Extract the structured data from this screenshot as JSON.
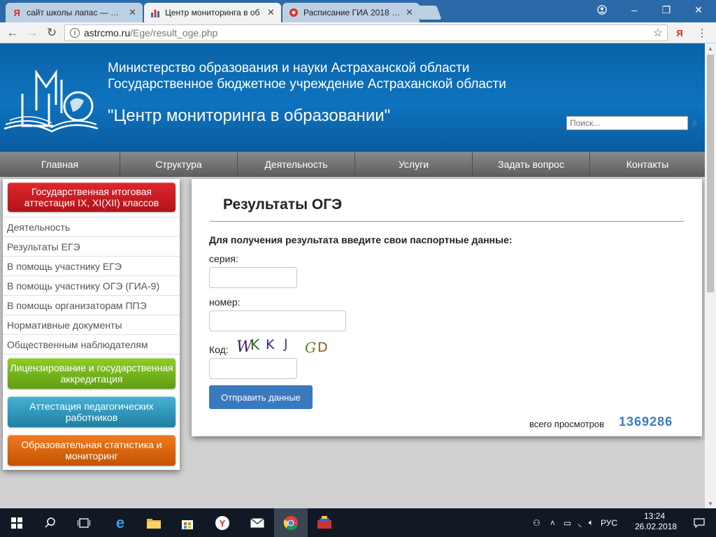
{
  "browser": {
    "tabs": [
      {
        "favicon": "Я",
        "title": "сайт школы лапас — Янд",
        "active": false
      },
      {
        "favicon": "chart-icon",
        "title": "Центр мониторинга в об",
        "active": true
      },
      {
        "favicon": "globe-icon",
        "title": "Расписание ГИА 2018 / О",
        "active": false
      }
    ],
    "url_host": "astrcmo.ru",
    "url_path": "/Ege/result_oge.php"
  },
  "header": {
    "org_line1": "Министерство образования и науки Астраханской области",
    "org_line2": "Государственное бюджетное учреждение Астраханской области",
    "org_line3": "\"Центр мониторинга в образовании\"",
    "search_placeholder": "Поиск..."
  },
  "nav": [
    "Главная",
    "Структура",
    "Деятельность",
    "Услуги",
    "Задать вопрос",
    "Контакты"
  ],
  "sidebar": {
    "top_button": "Государственная итоговая аттестация IX, XI(XII) классов",
    "links": [
      "Деятельность",
      "Результаты ЕГЭ",
      "В помощь участнику ЕГЭ",
      "В помощь участнику ОГЭ (ГИА-9)",
      "В помощь организаторам ППЭ",
      "Нормативные документы",
      "Общественным наблюдателям"
    ],
    "buttons": [
      {
        "label": "Лицензирование и государственная аккредитация",
        "color": "#7cb518"
      },
      {
        "label": "Аттестация педагогических работников",
        "color": "#2e95b8"
      },
      {
        "label": "Образовательная статистика и мониторинг",
        "color": "#d9620a"
      }
    ]
  },
  "form": {
    "title": "Результаты ОГЭ",
    "prompt": "Для получения результата введите свои паспортные данные:",
    "series_label": "серия:",
    "number_label": "номер:",
    "code_label": "Код:",
    "captcha_text": "WKKJ GD",
    "submit_label": "Отправить данные",
    "views_label": "всего просмотров",
    "views_count": "1369286"
  },
  "taskbar": {
    "time": "13:24",
    "date": "26.02.2018",
    "lang": "РУС"
  },
  "colors": {
    "header_blue": "#0e73bf",
    "red_button": "#c8161d",
    "submit_blue": "#3a79bf"
  }
}
